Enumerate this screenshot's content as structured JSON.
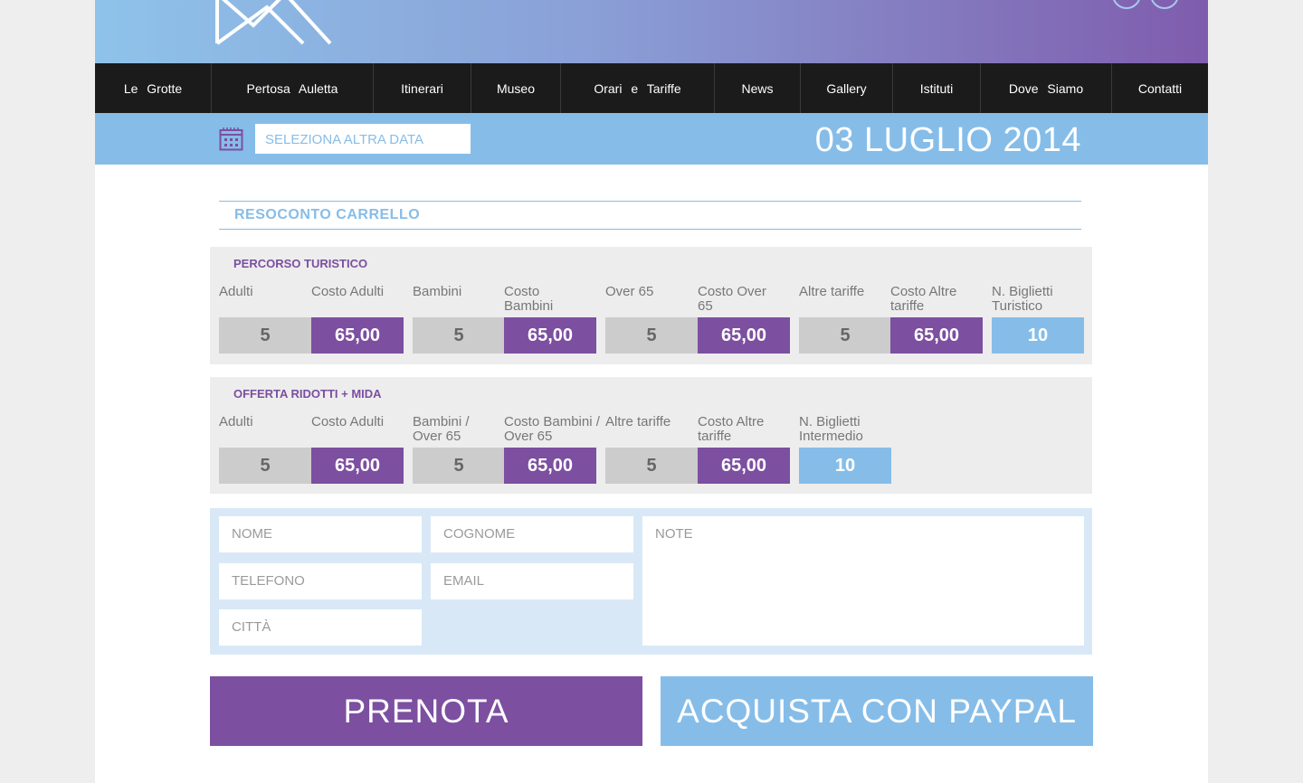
{
  "nav": {
    "items": [
      "Le Grotte",
      "Pertosa Auletta",
      "Itinerari",
      "Museo",
      "Orari e Tariffe",
      "News",
      "Gallery",
      "Istituti",
      "Dove Siamo",
      "Contatti"
    ]
  },
  "datebar": {
    "select_date_placeholder": "SELEZIONA ALTRA DATA",
    "current_date": "03 LUGLIO 2014"
  },
  "summary": {
    "title": "RESOCONTO CARRELLO"
  },
  "percorso": {
    "title": "PERCORSO TURISTICO",
    "labels": [
      "Adulti",
      "Costo Adulti",
      "Bambini",
      "Costo Bambini",
      "Over 65",
      "Costo Over 65",
      "Altre tariffe",
      "Costo Altre tariffe",
      "N. Biglietti Turistico"
    ],
    "values": [
      "5",
      "65,00",
      "5",
      "65,00",
      "5",
      "65,00",
      "5",
      "65,00",
      "10"
    ]
  },
  "offerta": {
    "title": "OFFERTA RIDOTTI + MIDA",
    "labels": [
      "Adulti",
      "Costo Adulti",
      "Bambini / Over 65",
      "Costo Bambini / Over 65",
      "Altre tariffe",
      "Costo Altre tariffe",
      "N. Biglietti Intermedio"
    ],
    "values": [
      "5",
      "65,00",
      "5",
      "65,00",
      "5",
      "65,00",
      "10"
    ]
  },
  "form": {
    "nome": "NOME",
    "cognome": "COGNOME",
    "note": "NOTE",
    "telefono": "TELEFONO",
    "email": "EMAIL",
    "citta": "CITTÀ"
  },
  "buttons": {
    "prenota": "PRENOTA",
    "paypal": "ACQUISTA CON PAYPAL"
  },
  "colors": {
    "purple": "#7c4fa0",
    "light_blue": "#86bde8",
    "nav_bg": "#1b1b1b",
    "gray_box": "#cccccc"
  }
}
